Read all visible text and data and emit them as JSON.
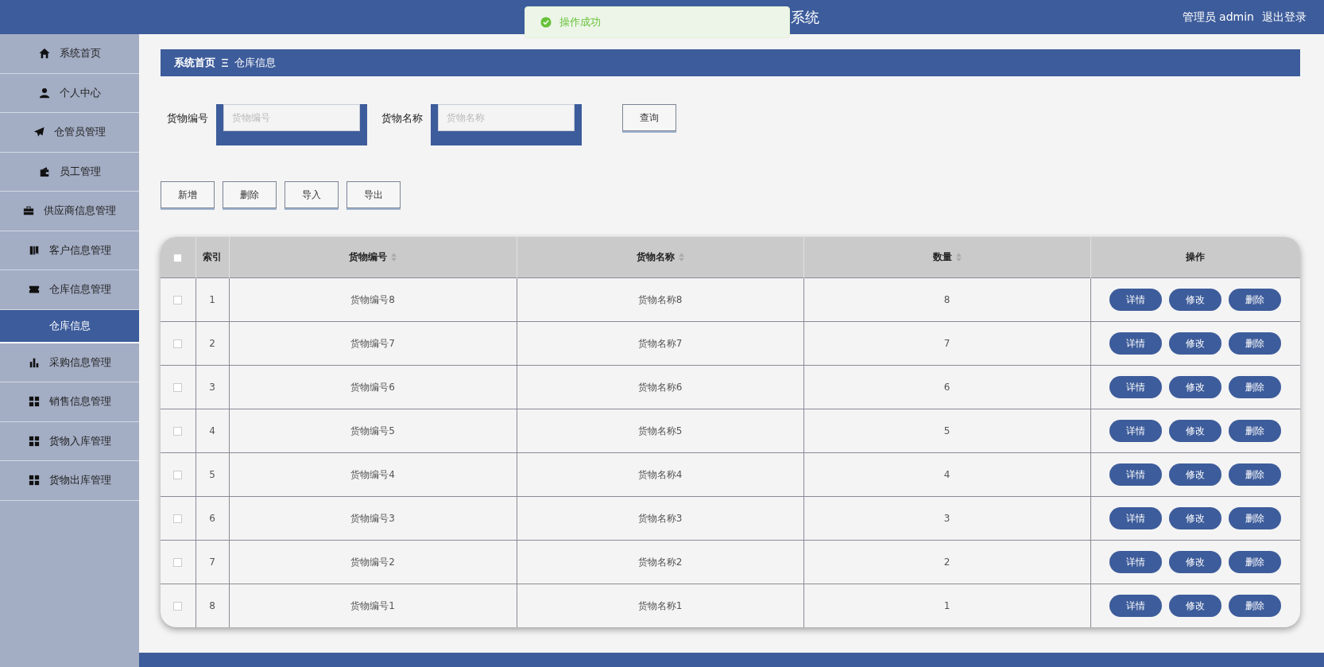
{
  "header": {
    "title": "系统",
    "user": "管理员 admin",
    "logout": "退出登录"
  },
  "toast": {
    "message": "操作成功"
  },
  "sidebar": {
    "items": [
      {
        "label": "系统首页",
        "kind": "menu",
        "selected": false
      },
      {
        "label": "个人中心",
        "kind": "menu",
        "selected": false
      },
      {
        "label": "仓管员管理",
        "kind": "menu",
        "selected": false
      },
      {
        "label": "员工管理",
        "kind": "menu",
        "selected": false
      },
      {
        "label": "供应商信息管理",
        "kind": "menu",
        "selected": false
      },
      {
        "label": "客户信息管理",
        "kind": "menu",
        "selected": false
      },
      {
        "label": "仓库信息管理",
        "kind": "menu",
        "selected": false
      },
      {
        "label": "仓库信息",
        "kind": "submenu",
        "selected": true
      },
      {
        "label": "采购信息管理",
        "kind": "menu",
        "selected": false
      },
      {
        "label": "销售信息管理",
        "kind": "menu",
        "selected": false
      },
      {
        "label": "货物入库管理",
        "kind": "menu",
        "selected": false
      },
      {
        "label": "货物出库管理",
        "kind": "menu",
        "selected": false
      }
    ]
  },
  "breadcrumb": {
    "items": [
      "系统首页",
      "仓库信息"
    ]
  },
  "search": {
    "fields": [
      {
        "label": "货物编号",
        "placeholder": "货物编号"
      },
      {
        "label": "货物名称",
        "placeholder": "货物名称"
      }
    ],
    "button": "查询"
  },
  "actions": [
    "新增",
    "删除",
    "导入",
    "导出"
  ],
  "table": {
    "select_all": {
      "checked": false
    },
    "columns": [
      {
        "label": "索引",
        "sortable": false
      },
      {
        "label": "货物编号",
        "sortable": true
      },
      {
        "label": "货物名称",
        "sortable": true
      },
      {
        "label": "数量",
        "sortable": true
      },
      {
        "label": "操作",
        "sortable": false
      }
    ],
    "rows": [
      {
        "checked": false,
        "cells": [
          "1",
          "货物编号8",
          "货物名称8",
          "8"
        ],
        "actions": [
          "详情",
          "修改",
          "删除"
        ]
      },
      {
        "checked": false,
        "cells": [
          "2",
          "货物编号7",
          "货物名称7",
          "7"
        ],
        "actions": [
          "详情",
          "修改",
          "删除"
        ]
      },
      {
        "checked": false,
        "cells": [
          "3",
          "货物编号6",
          "货物名称6",
          "6"
        ],
        "actions": [
          "详情",
          "修改",
          "删除"
        ]
      },
      {
        "checked": false,
        "cells": [
          "4",
          "货物编号5",
          "货物名称5",
          "5"
        ],
        "actions": [
          "详情",
          "修改",
          "删除"
        ]
      },
      {
        "checked": false,
        "cells": [
          "5",
          "货物编号4",
          "货物名称4",
          "4"
        ],
        "actions": [
          "详情",
          "修改",
          "删除"
        ]
      },
      {
        "checked": false,
        "cells": [
          "6",
          "货物编号3",
          "货物名称3",
          "3"
        ],
        "actions": [
          "详情",
          "修改",
          "删除"
        ]
      },
      {
        "checked": false,
        "cells": [
          "7",
          "货物编号2",
          "货物名称2",
          "2"
        ],
        "actions": [
          "详情",
          "修改",
          "删除"
        ]
      },
      {
        "checked": false,
        "cells": [
          "8",
          "货物编号1",
          "货物名称1",
          "1"
        ],
        "actions": [
          "详情",
          "修改",
          "删除"
        ]
      }
    ]
  }
}
